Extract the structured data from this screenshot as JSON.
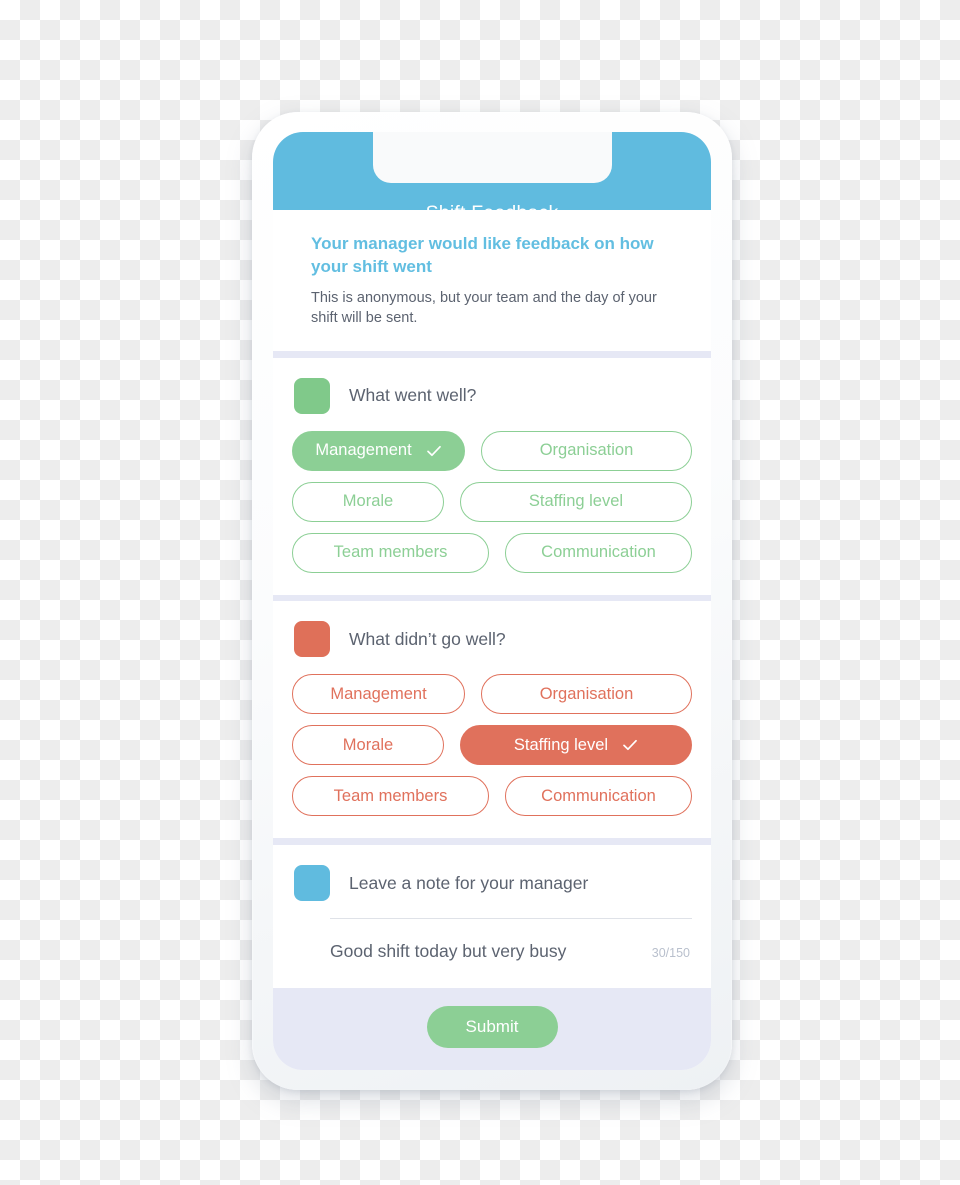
{
  "header": {
    "title": "Shift Feedback"
  },
  "intro": {
    "heading": "Your manager would like feedback on how your shift went",
    "subtext": "This is anonymous, but your team and the day of your shift will be sent."
  },
  "colors": {
    "blue": "#60bbdf",
    "green": "#8ccf95",
    "red": "#e0715c",
    "divider": "#e6e8f5",
    "text": "#5c6370",
    "counter": "#b9c0cd"
  },
  "positive_section": {
    "title": "What went well?",
    "swatch_color": "#80c98a",
    "options": [
      {
        "label": "Management",
        "selected": true
      },
      {
        "label": "Organisation",
        "selected": false
      },
      {
        "label": "Morale",
        "selected": false
      },
      {
        "label": "Staffing level",
        "selected": false
      },
      {
        "label": "Team members",
        "selected": false
      },
      {
        "label": "Communication",
        "selected": false
      }
    ]
  },
  "negative_section": {
    "title": "What didn’t go well?",
    "swatch_color": "#df7059",
    "options": [
      {
        "label": "Management",
        "selected": false
      },
      {
        "label": "Organisation",
        "selected": false
      },
      {
        "label": "Morale",
        "selected": false
      },
      {
        "label": "Staffing level",
        "selected": true
      },
      {
        "label": "Team members",
        "selected": false
      },
      {
        "label": "Communication",
        "selected": false
      }
    ]
  },
  "note_section": {
    "title": "Leave a note for your manager",
    "swatch_color": "#60bbdf",
    "value": "Good shift today but very busy",
    "placeholder": "Leave a note for your manager",
    "counter": "30/150"
  },
  "footer": {
    "submit_label": "Submit"
  }
}
